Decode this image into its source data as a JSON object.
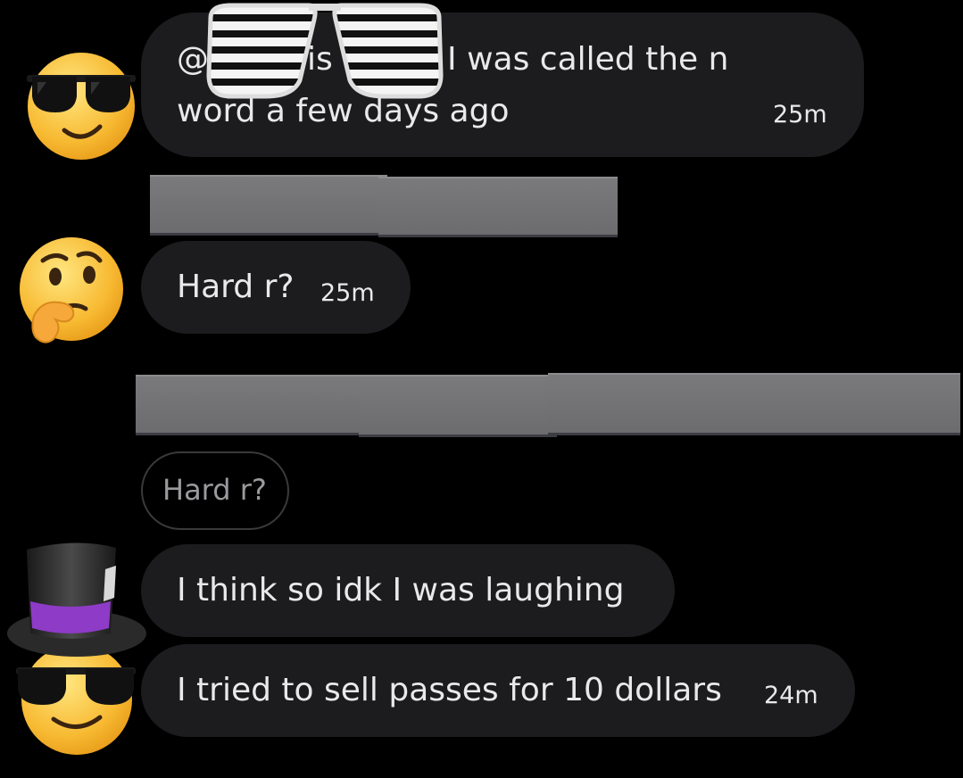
{
  "colors": {
    "background": "#000000",
    "bubble": "#1c1c1e",
    "text": "#e9e9eb",
    "redaction": "#757577",
    "reply_text": "#9a9a9e"
  },
  "messages": [
    {
      "avatar_icon": "sunglasses-emoji-icon",
      "line1_prefix": "@",
      "line1_fragment": "lis",
      "line1_suffix": "n I was called the n",
      "line2": "word a few days ago",
      "time": "25m"
    },
    {
      "avatar_icon": "thinking-face-emoji-icon",
      "text": "Hard r?",
      "time": "25m"
    },
    {
      "reply_quote": "Hard r?",
      "avatar_icon": "top-hat-sunglasses-emoji-icon",
      "text": "I think so idk I was laughing"
    },
    {
      "text": "I tried to sell passes for 10 dollars",
      "time": "24m"
    }
  ],
  "overlay_icon": "shutter-shades-icon",
  "redaction_icon": "redaction-bar"
}
